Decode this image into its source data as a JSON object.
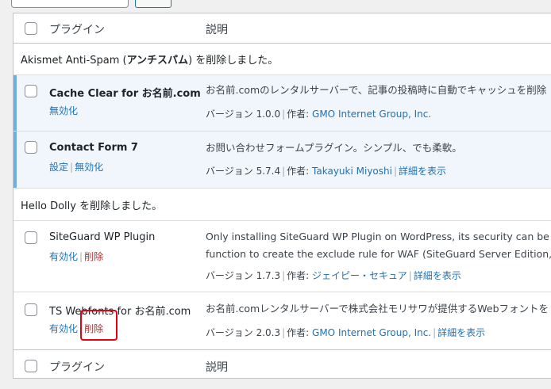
{
  "header": {
    "col_plugin": "プラグイン",
    "col_description": "説明"
  },
  "footer": {
    "col_plugin": "プラグイン",
    "col_description": "説明"
  },
  "notices": {
    "akismet_prefix": "Akismet Anti-Spam (",
    "akismet_bold": "アンチスパム",
    "akismet_suffix": ") を削除しました。",
    "hello_dolly": "Hello Dolly を削除しました。"
  },
  "plugins": [
    {
      "name": "Cache Clear for お名前.com",
      "actions": [
        "無効化"
      ],
      "description_lines": [
        "お名前.comのレンタルサーバーで、記事の投稿時に自動でキャッシュを削除"
      ],
      "version_text": "バージョン 1.0.0",
      "author_label": "作者:",
      "author": "GMO Internet Group, Inc.",
      "details": ""
    },
    {
      "name": "Contact Form 7",
      "actions": [
        "設定",
        "無効化"
      ],
      "description_lines": [
        "お問い合わせフォームプラグイン。シンプル、でも柔軟。"
      ],
      "version_text": "バージョン 5.7.4",
      "author_label": "作者:",
      "author": "Takayuki Miyoshi",
      "details": "詳細を表示"
    },
    {
      "name": "SiteGuard WP Plugin",
      "actions": [
        "有効化",
        "削除"
      ],
      "description_lines": [
        "Only installing SiteGuard WP Plugin on WordPress, its security can be improv",
        "function to create the exclude rule for WAF (SiteGuard Server Edition, to use"
      ],
      "version_text": "バージョン 1.7.3",
      "author_label": "作者:",
      "author": "ジェイピー・セキュア",
      "details": "詳細を表示"
    },
    {
      "name": "TS Webfonts for お名前.com",
      "actions": [
        "有効化",
        "削除"
      ],
      "description_lines": [
        "お名前.comレンタルサーバーで株式会社モリサワが提供するWebフォントを"
      ],
      "version_text": "バージョン 2.0.3",
      "author_label": "作者:",
      "author": "GMO Internet Group, Inc.",
      "details": "詳細を表示"
    }
  ],
  "colors": {
    "link": "#2271b1",
    "delete": "#b32d2e",
    "active_row_bg": "#f0f6fc",
    "active_row_border": "#72aee6",
    "highlight": "#e60012"
  }
}
